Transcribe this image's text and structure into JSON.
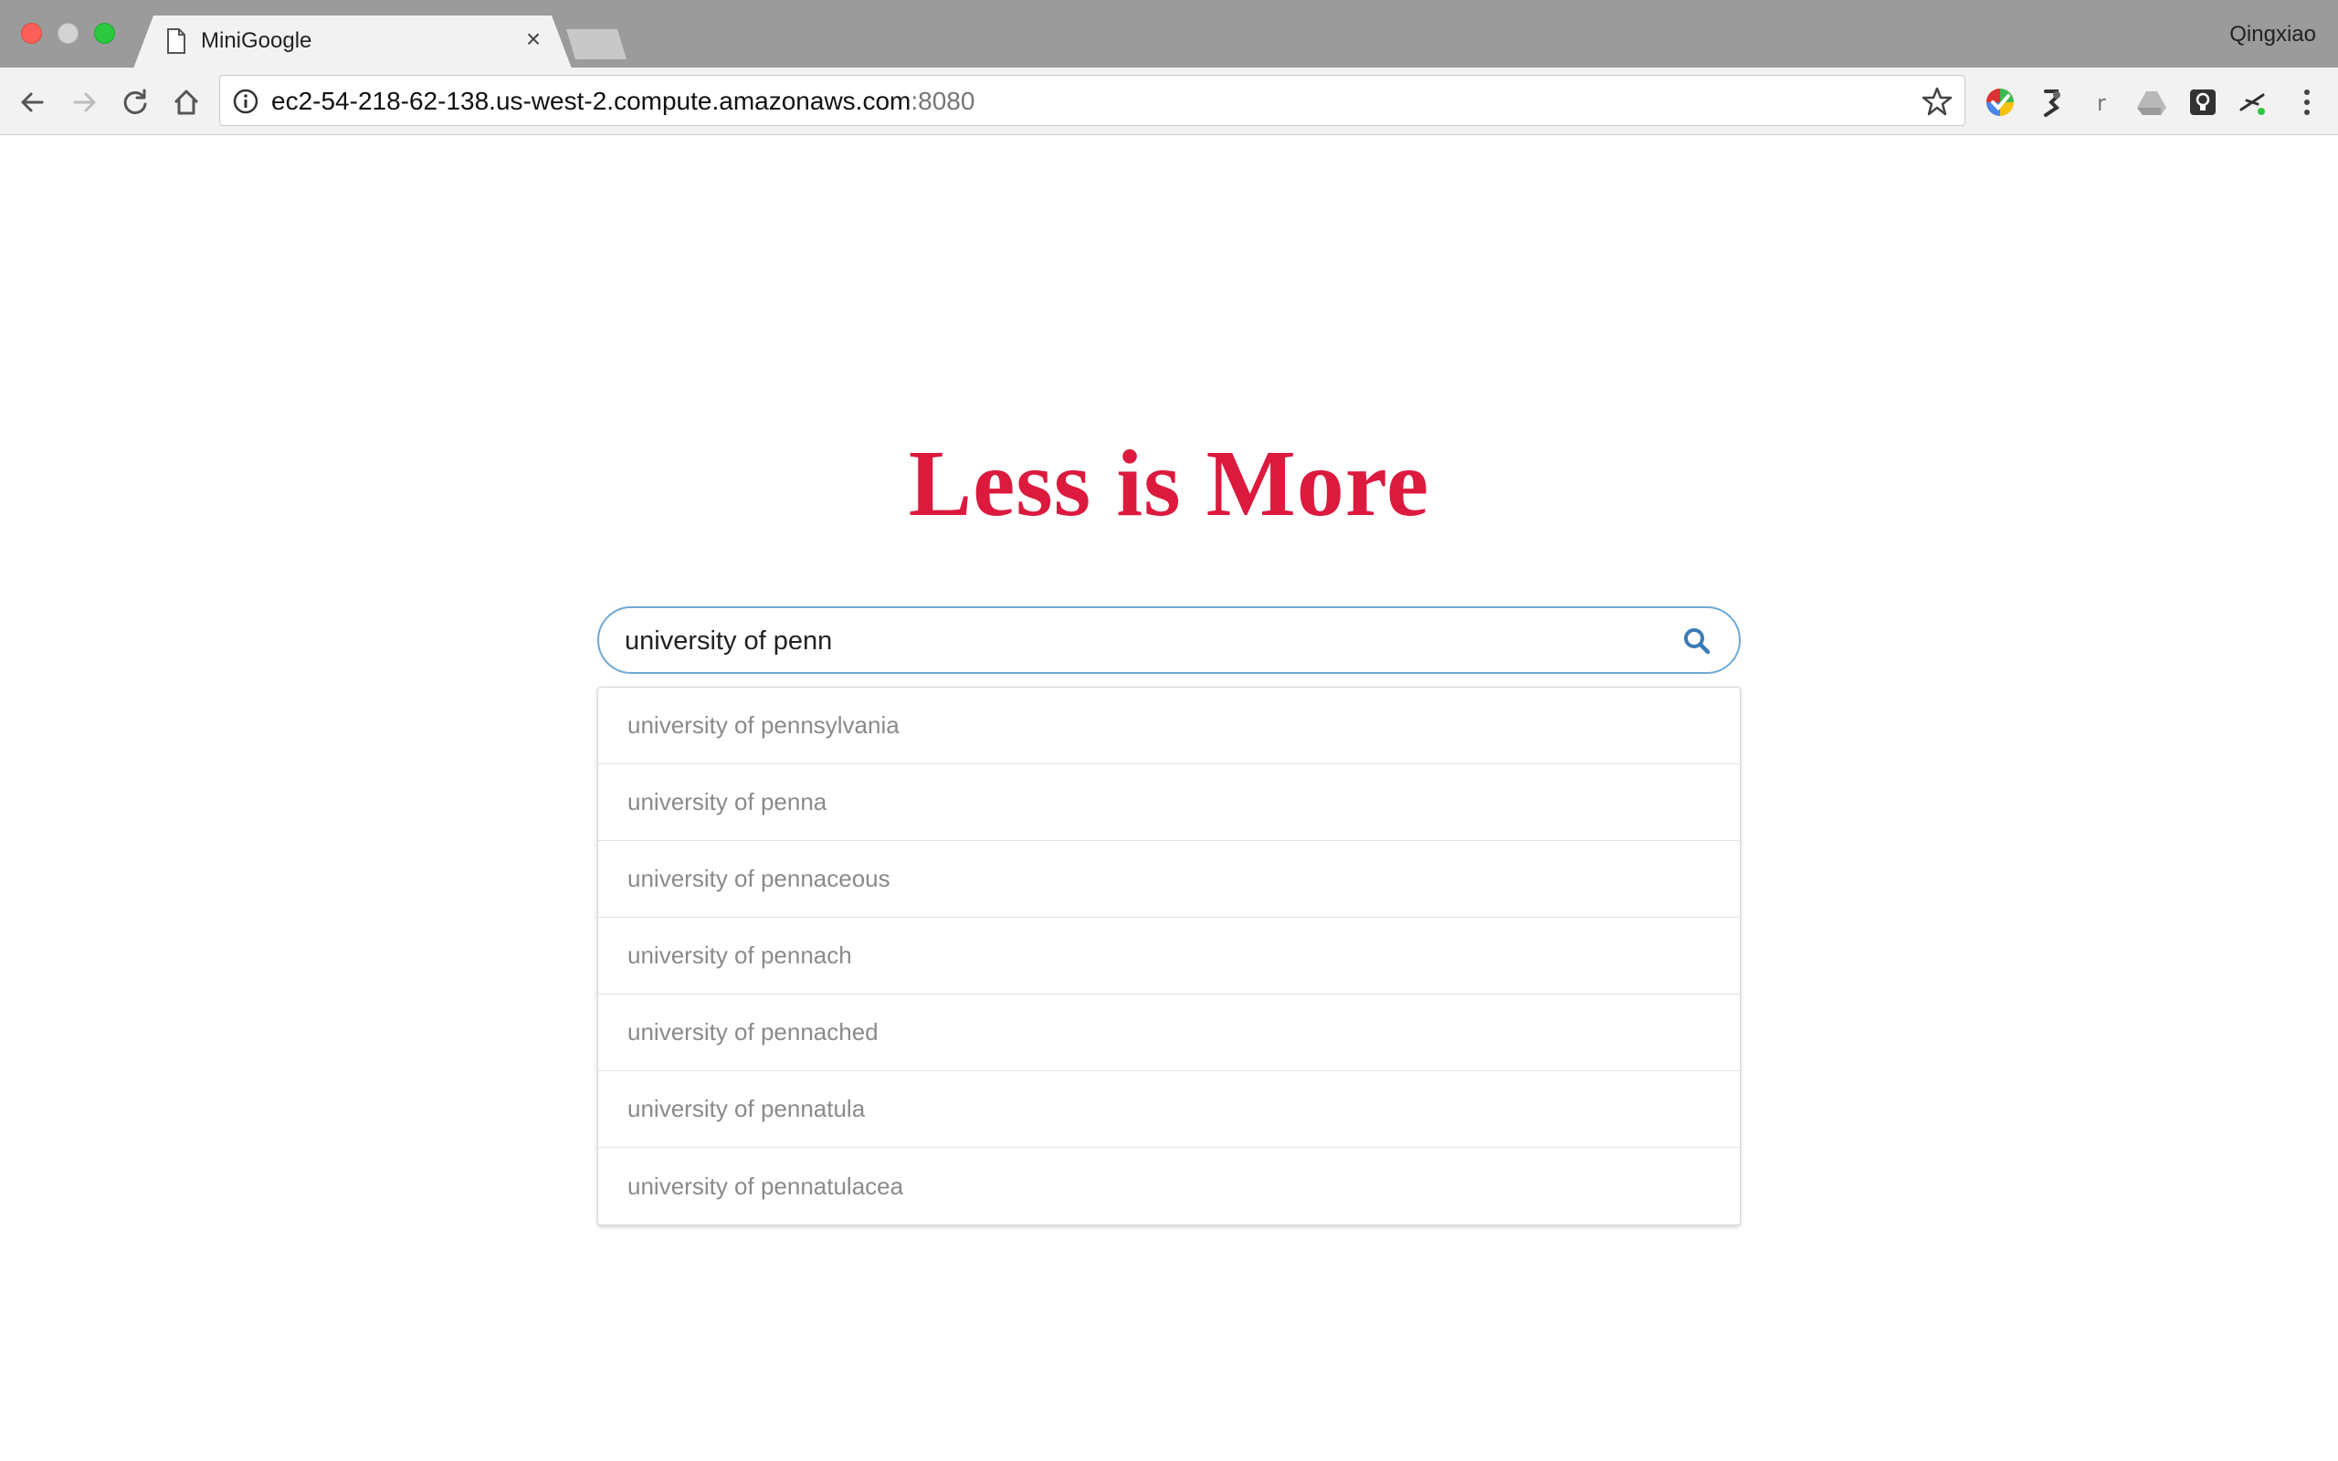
{
  "window": {
    "profile_name": "Qingxiao"
  },
  "tabs": [
    {
      "title": "MiniGoogle",
      "active": true
    }
  ],
  "toolbar": {
    "url_host": "ec2-54-218-62-138.us-west-2.compute.amazonaws.com",
    "url_port": ":8080",
    "extensions": [
      "rainbow-ext-icon",
      "tool-ext-icon",
      "r-ext-icon",
      "drive-ext-icon",
      "bulb-ext-icon",
      "antenna-ext-icon"
    ]
  },
  "page": {
    "headline": "Less is More",
    "search_value": "university of penn",
    "suggestions": [
      "university of pennsylvania",
      "university of penna",
      "university of pennaceous",
      "university of pennach",
      "university of pennached",
      "university of pennatula",
      "university of pennatulacea"
    ]
  },
  "colors": {
    "headline": "#dc1a3e",
    "search_border": "#6fa8d3",
    "search_icon": "#3b7bb6",
    "suggestion_text": "#8a8a8a"
  }
}
